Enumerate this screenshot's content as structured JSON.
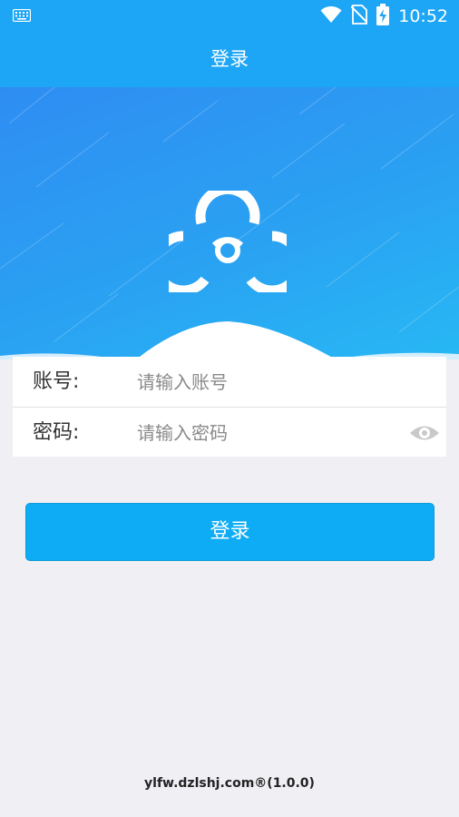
{
  "status_bar": {
    "time": "10:52",
    "icons": [
      "keyboard-icon",
      "wifi-icon",
      "no-sim-icon",
      "battery-charging-icon"
    ]
  },
  "header": {
    "title": "登录"
  },
  "banner": {
    "logo_icon": "biohazard-icon"
  },
  "form": {
    "account_label": "账号:",
    "account_placeholder": "请输入账号",
    "password_label": "密码:",
    "password_placeholder": "请输入密码",
    "toggle_icon": "eye-icon"
  },
  "login_button": {
    "label": "登录"
  },
  "footer": {
    "text": "ylfw.dzlshj.com®(1.0.0)"
  },
  "colors": {
    "primary": "#1ea6f6",
    "button": "#0eacf4",
    "background": "#efeff4"
  }
}
